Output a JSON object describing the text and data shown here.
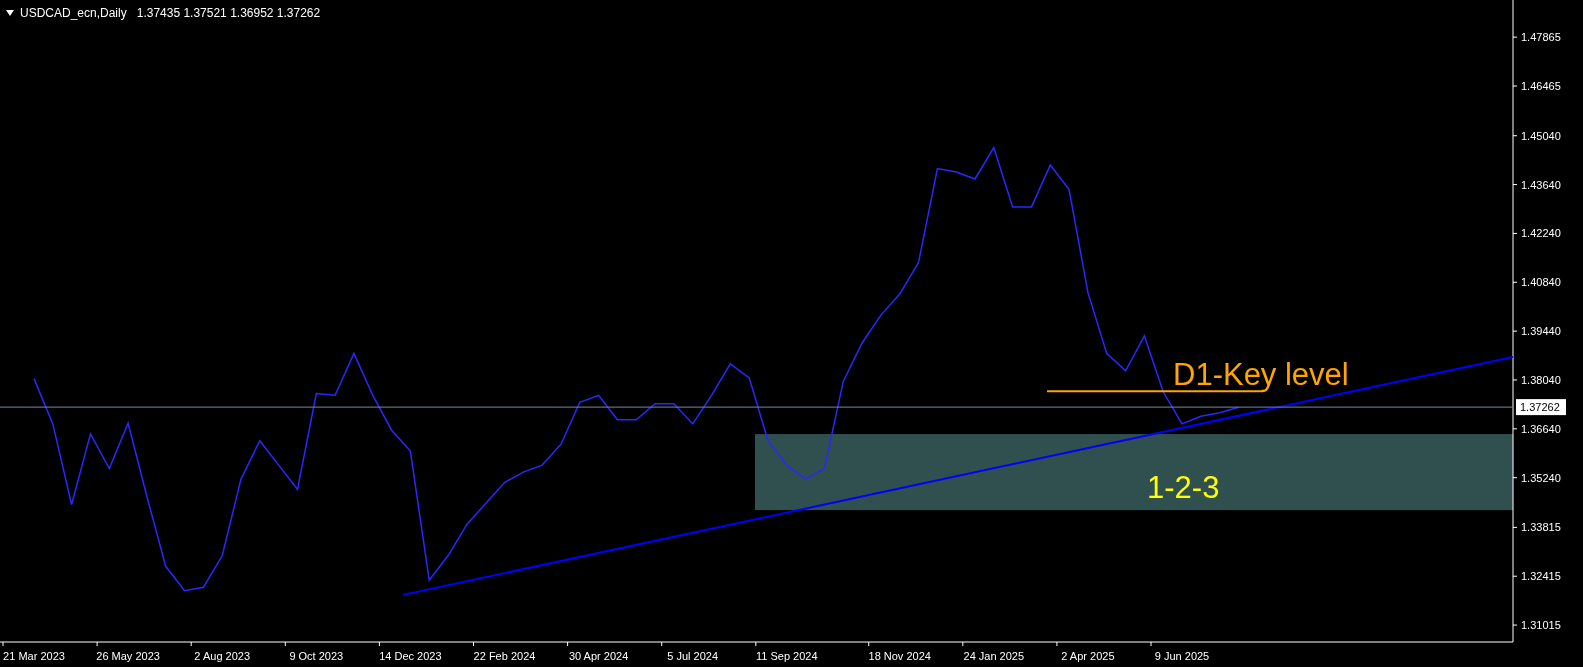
{
  "header": {
    "symbol": "USDCAD_ecn,Daily",
    "quote": "1.37435 1.37521 1.36952 1.37262"
  },
  "chart": {
    "chart_data": {
      "type": "line",
      "categories": [
        "21 Mar 2023",
        null,
        null,
        null,
        null,
        "26 May 2023",
        null,
        null,
        null,
        null,
        "2 Aug 2023",
        null,
        null,
        null,
        null,
        "9 Oct 2023",
        null,
        null,
        null,
        null,
        "14 Dec 2023",
        null,
        null,
        null,
        null,
        "22 Feb 2024",
        null,
        null,
        null,
        null,
        "30 Apr 2024",
        null,
        null,
        null,
        null,
        "5 Jul 2024",
        null,
        null,
        null,
        null,
        "11 Sep 2024",
        null,
        null,
        null,
        null,
        null,
        "18 Nov 2024",
        null,
        null,
        null,
        null,
        "24 Jan 2025",
        null,
        null,
        null,
        null,
        "2 Apr 2025",
        null,
        null,
        null,
        null,
        "9 Jun 2025",
        null,
        null,
        null
      ],
      "series": [
        {
          "color": "#2828ff",
          "values": [
            1.3808,
            1.3678,
            1.3447,
            1.3649,
            1.355,
            1.368,
            1.347,
            1.327,
            1.32,
            1.321,
            1.33,
            1.352,
            1.363,
            1.356,
            1.349,
            1.3765,
            1.376,
            1.388,
            1.376,
            1.366,
            1.36,
            1.323,
            1.33,
            1.339,
            1.345,
            1.351,
            1.354,
            1.356,
            1.362,
            1.374,
            1.376,
            1.369,
            1.369,
            1.3736,
            1.3736,
            1.3678,
            1.376,
            1.385,
            1.381,
            1.363,
            1.356,
            1.352,
            1.355,
            1.38,
            1.391,
            1.399,
            1.405,
            1.414,
            1.441,
            1.44,
            1.438,
            1.447,
            1.43,
            1.43,
            1.442,
            1.435,
            1.4055,
            1.388,
            1.383,
            1.393,
            1.377,
            1.3678,
            1.37,
            1.371,
            1.3726
          ]
        }
      ],
      "ylim": [
        1.3053,
        1.4893
      ],
      "yticks": [
        {
          "value": 1.47865,
          "label": "1.47865"
        },
        {
          "value": 1.46465,
          "label": "1.46465"
        },
        {
          "value": 1.4504,
          "label": "1.45040"
        },
        {
          "value": 1.4364,
          "label": "1.43640"
        },
        {
          "value": 1.4224,
          "label": "1.42240"
        },
        {
          "value": 1.4084,
          "label": "1.40840"
        },
        {
          "value": 1.3944,
          "label": "1.39440"
        },
        {
          "value": 1.3804,
          "label": "1.38040"
        },
        {
          "value": 1.3664,
          "label": "1.36640"
        },
        {
          "value": 1.3524,
          "label": "1.35240"
        },
        {
          "value": 1.33815,
          "label": "1.33815"
        },
        {
          "value": 1.32415,
          "label": "1.32415"
        },
        {
          "value": 1.31015,
          "label": "1.31015"
        }
      ],
      "annotations": [
        "D1-Key level",
        "1-2-3"
      ]
    },
    "current_price": "1.37262"
  }
}
